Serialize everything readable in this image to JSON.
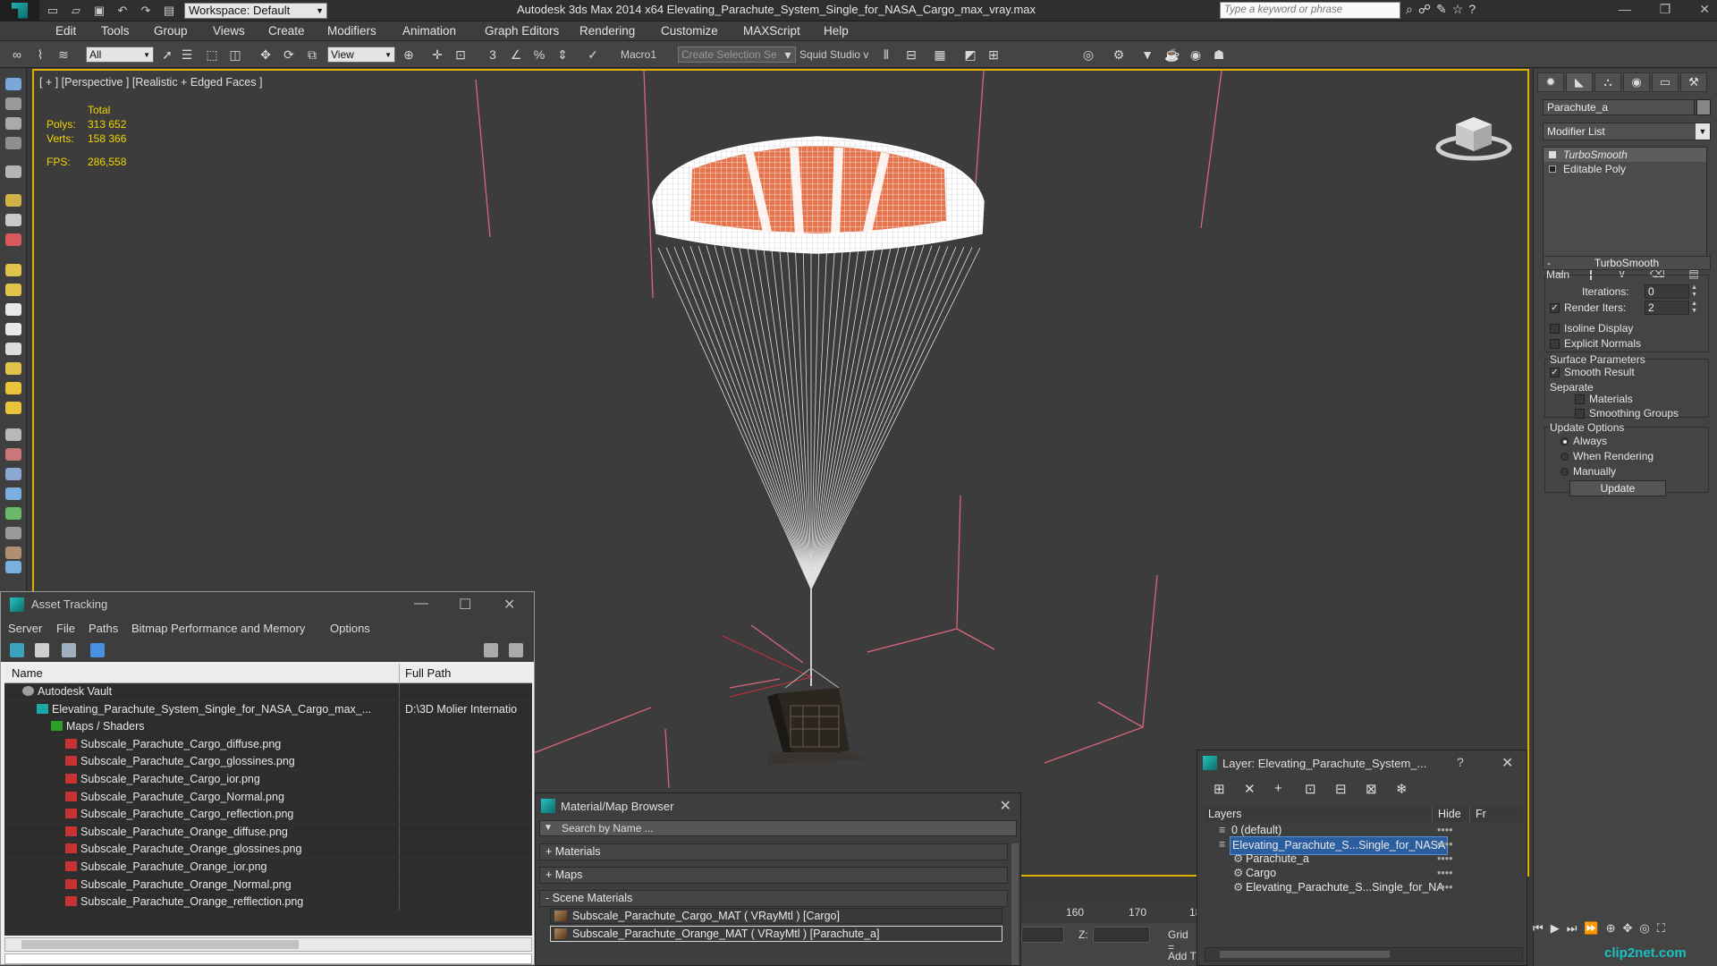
{
  "app": {
    "title": "Autodesk 3ds Max  2014 x64     Elevating_Parachute_System_Single_for_NASA_Cargo_max_vray.max",
    "workspace": "Workspace: Default",
    "search_placeholder": "Type a keyword or phrase"
  },
  "menu": [
    "Edit",
    "Tools",
    "Group",
    "Views",
    "Create",
    "Modifiers",
    "Animation",
    "Graph Editors",
    "Rendering",
    "Customize",
    "MAXScript",
    "Help"
  ],
  "toolbar": {
    "filter": "All",
    "ref_coord": "View",
    "macro": "Macro1",
    "selection_set": "Create Selection Se",
    "squid": "Squid Studio v"
  },
  "viewport": {
    "label": "[ + ] [Perspective ] [Realistic + Edged Faces ]",
    "stats": {
      "header": "Total",
      "polys_label": "Polys:",
      "polys": "313 652",
      "verts_label": "Verts:",
      "verts": "158 366",
      "fps_label": "FPS:",
      "fps": "286,558"
    }
  },
  "command_panel": {
    "object_name": "Parachute_a",
    "modifier_list": "Modifier List",
    "stack": [
      "TurboSmooth",
      "Editable Poly"
    ],
    "rollout": "TurboSmooth",
    "main_label": "Main",
    "iterations_label": "Iterations:",
    "iterations": "0",
    "render_iters_label": "Render Iters:",
    "render_iters": "2",
    "isoline": "Isoline Display",
    "explicit_normals": "Explicit Normals",
    "surface_params": "Surface Parameters",
    "smooth_result": "Smooth Result",
    "separate": "Separate",
    "materials": "Materials",
    "smoothing_groups": "Smoothing Groups",
    "update_options": "Update Options",
    "always": "Always",
    "when_rendering": "When Rendering",
    "manually": "Manually",
    "update_btn": "Update"
  },
  "asset_tracking": {
    "title": "Asset Tracking",
    "menu": [
      "Server",
      "File",
      "Paths",
      "Bitmap Performance and Memory",
      "Options"
    ],
    "col_name": "Name",
    "col_path": "Full Path",
    "rows": [
      {
        "name": "Autodesk Vault",
        "path": "",
        "indent": 1,
        "icon": "vault"
      },
      {
        "name": "Elevating_Parachute_System_Single_for_NASA_Cargo_max_...",
        "path": "D:\\3D Molier Internatio",
        "indent": 2,
        "icon": "max"
      },
      {
        "name": "Maps / Shaders",
        "path": "",
        "indent": 3,
        "icon": "folder"
      },
      {
        "name": "Subscale_Parachute_Cargo_diffuse.png",
        "path": "",
        "indent": 4,
        "icon": "png"
      },
      {
        "name": "Subscale_Parachute_Cargo_glossines.png",
        "path": "",
        "indent": 4,
        "icon": "png"
      },
      {
        "name": "Subscale_Parachute_Cargo_ior.png",
        "path": "",
        "indent": 4,
        "icon": "png"
      },
      {
        "name": "Subscale_Parachute_Cargo_Normal.png",
        "path": "",
        "indent": 4,
        "icon": "png"
      },
      {
        "name": "Subscale_Parachute_Cargo_reflection.png",
        "path": "",
        "indent": 4,
        "icon": "png"
      },
      {
        "name": "Subscale_Parachute_Orange_diffuse.png",
        "path": "",
        "indent": 4,
        "icon": "png"
      },
      {
        "name": "Subscale_Parachute_Orange_glossines.png",
        "path": "",
        "indent": 4,
        "icon": "png"
      },
      {
        "name": "Subscale_Parachute_Orange_ior.png",
        "path": "",
        "indent": 4,
        "icon": "png"
      },
      {
        "name": "Subscale_Parachute_Orange_Normal.png",
        "path": "",
        "indent": 4,
        "icon": "png"
      },
      {
        "name": "Subscale_Parachute_Orange_refflection.png",
        "path": "",
        "indent": 4,
        "icon": "png"
      }
    ]
  },
  "material_browser": {
    "title": "Material/Map Browser",
    "search": "Search by Name ...",
    "groups": [
      "+ Materials",
      "+ Maps",
      "- Scene Materials"
    ],
    "materials": [
      "Subscale_Parachute_Cargo_MAT  ( VRayMtl ) [Cargo]",
      "Subscale_Parachute_Orange_MAT  ( VRayMtl ) [Parachute_a]"
    ]
  },
  "layer_window": {
    "title": "Layer: Elevating_Parachute_System_...",
    "col_layers": "Layers",
    "col_hide": "Hide",
    "col_freeze": "Fr",
    "rows": [
      {
        "name": "0 (default)",
        "indent": 1
      },
      {
        "name": "Elevating_Parachute_S...Single_for_NASA",
        "indent": 1
      },
      {
        "name": "Parachute_a",
        "indent": 2
      },
      {
        "name": "Cargo",
        "indent": 2
      },
      {
        "name": "Elevating_Parachute_S...Single_for_NA",
        "indent": 2
      }
    ]
  },
  "timeline": {
    "t1": "160",
    "t2": "170",
    "t3": "18"
  },
  "coords": {
    "z_label": "Z:",
    "grid": "Grid =",
    "add_time": "Add T"
  },
  "watermark": "clip2net.com",
  "colors": {
    "viewport_border": "#e0b000",
    "stats": "#f2d600",
    "canopy_orange": "#e25b2e",
    "selection": "#2b5e9e"
  }
}
